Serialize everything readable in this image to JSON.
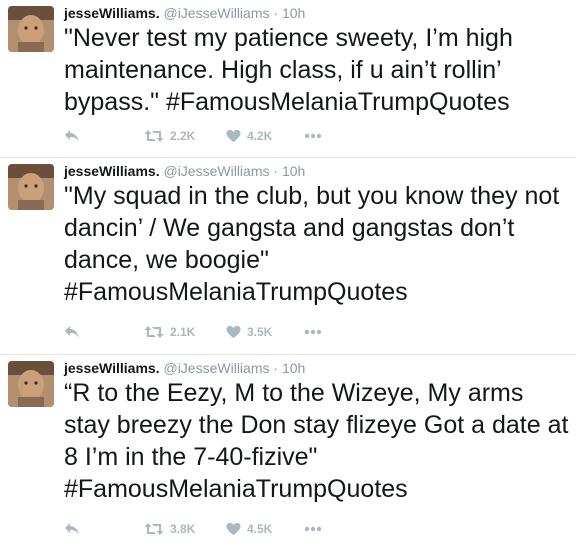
{
  "tweets": [
    {
      "name": "jesseWilliams.",
      "handle": "@iJesseWilliams",
      "separator": "·",
      "time": "10h",
      "text": "\"Never test my patience sweety, I’m high maintenance. High class, if u ain’t rollin’ bypass.\" #FamousMelaniaTrumpQuotes",
      "retweets": "2.2K",
      "likes": "4.2K"
    },
    {
      "name": "jesseWilliams.",
      "handle": "@iJesseWilliams",
      "separator": "·",
      "time": "10h",
      "text": "\"My squad in the club, but you know they not dancin’ / We gangsta and gangstas don’t dance, we boogie\" #FamousMelaniaTrumpQuotes",
      "retweets": "2.1K",
      "likes": "3.5K"
    },
    {
      "name": "jesseWilliams.",
      "handle": "@iJesseWilliams",
      "separator": "·",
      "time": "10h",
      "text": "“R to the Eezy, M to the Wizeye, My arms stay breezy the Don stay flizeye Got a date at 8 I’m in the 7-40-fizive\" #FamousMelaniaTrumpQuotes",
      "retweets": "3.8K",
      "likes": "4.5K"
    }
  ],
  "icons": {
    "reply": "reply-icon",
    "retweet": "retweet-icon",
    "like": "heart-icon",
    "more": "more-icon",
    "accent": "#aab8c2"
  }
}
